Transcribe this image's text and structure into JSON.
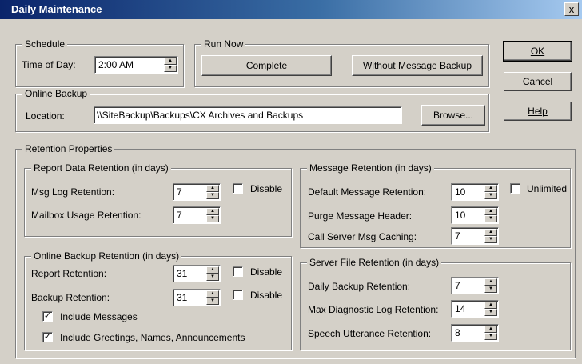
{
  "window": {
    "title": "Daily Maintenance",
    "close_glyph": "x"
  },
  "schedule": {
    "label": "Schedule",
    "time_label": "Time of Day:",
    "time_value": "2:00 AM"
  },
  "run_now": {
    "label": "Run Now",
    "complete": "Complete",
    "without_backup": "Without Message Backup"
  },
  "online_backup": {
    "label": "Online Backup",
    "location_label": "Location:",
    "location_value": "\\\\SiteBackup\\Backups\\CX Archives and Backups",
    "browse": "Browse..."
  },
  "buttons": {
    "ok": "OK",
    "cancel": "Cancel",
    "help": "Help"
  },
  "retention": {
    "label": "Retention Properties",
    "report_data": {
      "label": "Report Data Retention (in days)",
      "msg_log_label": "Msg Log Retention:",
      "msg_log_value": "7",
      "mailbox_label": "Mailbox Usage Retention:",
      "mailbox_value": "7",
      "disable": "Disable"
    },
    "online_backup": {
      "label": "Online Backup Retention (in days)",
      "report_label": "Report Retention:",
      "report_value": "31",
      "backup_label": "Backup Retention:",
      "backup_value": "31",
      "disable_1": "Disable",
      "disable_2": "Disable",
      "include_messages": "Include Messages",
      "include_greetings": "Include Greetings, Names, Announcements"
    },
    "message": {
      "label": "Message Retention (in days)",
      "default_label": "Default Message Retention:",
      "default_value": "10",
      "purge_label": "Purge Message Header:",
      "purge_value": "10",
      "caching_label": "Call Server Msg Caching:",
      "caching_value": "7",
      "unlimited": "Unlimited"
    },
    "server_file": {
      "label": "Server File Retention (in days)",
      "daily_label": "Daily Backup Retention:",
      "daily_value": "7",
      "diag_label": "Max Diagnostic Log Retention:",
      "diag_value": "14",
      "speech_label": "Speech Utterance Retention:",
      "speech_value": "8"
    }
  },
  "check_glyph": "✓"
}
